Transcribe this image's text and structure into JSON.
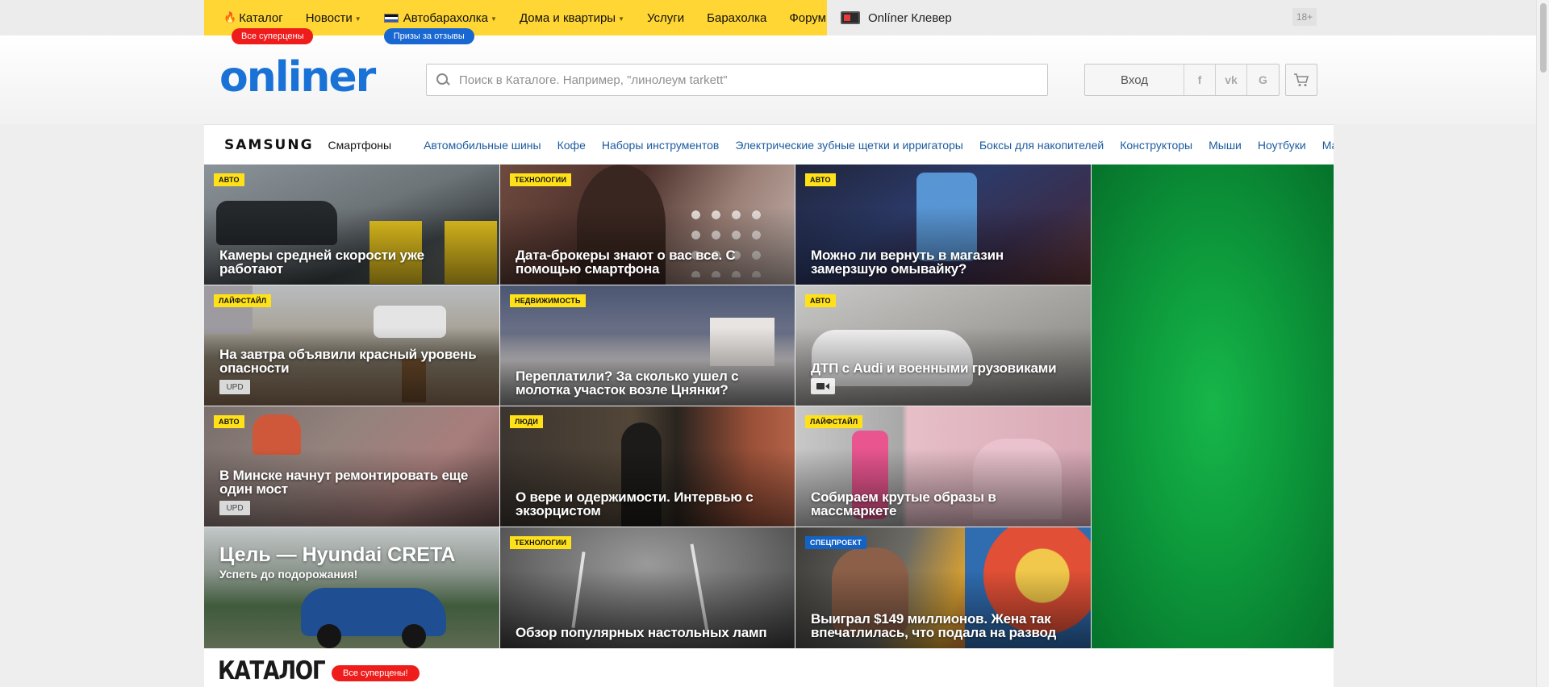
{
  "topnav": {
    "items": [
      {
        "label": "Каталог",
        "icon": "fire-icon",
        "badge": "Все суперцены",
        "chevron": false
      },
      {
        "label": "Новости",
        "chevron": true
      },
      {
        "label": "Автобарахолка",
        "icon": "flag-icon",
        "badge": "Призы за отзывы",
        "chevron": true
      },
      {
        "label": "Дома и квартиры",
        "chevron": true
      },
      {
        "label": "Услуги",
        "chevron": false
      },
      {
        "label": "Барахолка",
        "chevron": false
      },
      {
        "label": "Форум",
        "chevron": false
      }
    ],
    "klever": "Onlíner Клевер",
    "age_rating": "18+"
  },
  "header": {
    "logo": "onliner",
    "search_placeholder": "Поиск в Каталоге. Например, \"линолеум tarkett\"",
    "login_label": "Вход",
    "social": [
      "f",
      "vk",
      "G"
    ]
  },
  "promobar": {
    "brand": "SAMSUNG",
    "brand_category": "Смартфоны",
    "links": [
      "Автомобильные шины",
      "Кофе",
      "Наборы инструментов",
      "Электрические зубные щетки и ирригаторы",
      "Боксы для накопителей",
      "Конструкторы",
      "Мыши",
      "Ноутбуки",
      "Масс"
    ]
  },
  "news": [
    {
      "label": "Авто",
      "title": "Камеры средней скорости уже работают",
      "upd": "",
      "video": false
    },
    {
      "label": "Технологии",
      "title": "Дата-брокеры знают о вас все. С помощью смартфона",
      "upd": "",
      "video": false
    },
    {
      "label": "Авто",
      "title": "Можно ли вернуть в магазин замерзшую омывайку?",
      "upd": "",
      "video": false
    },
    {
      "label": "Лайфстайл",
      "title": "На завтра объявили красный уровень опасности",
      "upd": "UPD",
      "video": false
    },
    {
      "label": "Недвижимость",
      "title": "Переплатили? За сколько ушел с молотка участок возле Цнянки?",
      "upd": "",
      "video": false
    },
    {
      "label": "Авто",
      "title": "ДТП с Audi и военными грузовиками",
      "upd": "",
      "video": true
    },
    {
      "label": "Авто",
      "title": "В Минске начнут ремонтировать еще один мост",
      "upd": "UPD",
      "video": false
    },
    {
      "label": "Люди",
      "title": "О вере и одержимости. Интервью с экзорцистом",
      "upd": "",
      "video": false
    },
    {
      "label": "Лайфстайл",
      "title": "Собираем крутые образы в массмаркете",
      "upd": "",
      "video": false
    },
    {
      "label": "",
      "title": "",
      "ad_title": "Цель — Hyundai CRETA",
      "ad_sub": "Успеть до подорожания!",
      "upd": "",
      "video": false
    },
    {
      "label": "Технологии",
      "title": "Обзор популярных настольных ламп",
      "upd": "",
      "video": false
    },
    {
      "label": "Спецпроект",
      "title": "Выиграл $149 миллионов. Жена так впечатлилась, что подала на развод",
      "upd": "",
      "video": false
    }
  ],
  "catalog": {
    "title": "КАТАЛОГ",
    "badge": "Все суперцены!"
  },
  "colors": {
    "topbar_yellow": "#ffd633",
    "brand_blue": "#1a72d6",
    "label_yellow": "#ffe11a",
    "label_blue": "#1463c4",
    "badge_red": "#ef1c1c",
    "ad_green": "#0d9a3c"
  }
}
